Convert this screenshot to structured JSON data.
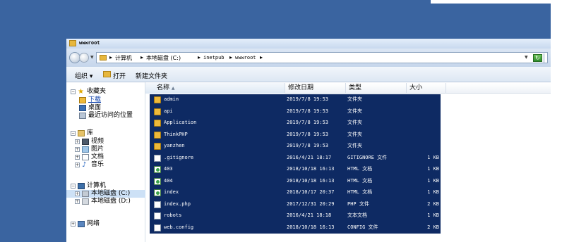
{
  "window": {
    "title": "wwwroot"
  },
  "address": {
    "crumbs": [
      "计算机",
      "本地磁盘 (C:)",
      "inetpub",
      "wwwroot"
    ],
    "separator": "▸"
  },
  "toolbar": {
    "organize": "组织 ▾",
    "open": "打开",
    "new_folder": "新建文件夹"
  },
  "nav": {
    "favorites": "收藏夹",
    "downloads": "下载",
    "desktop": "桌面",
    "recent": "最近访问的位置",
    "libraries": "库",
    "videos": "视频",
    "pictures": "图片",
    "documents": "文档",
    "music": "音乐",
    "computer": "计算机",
    "drive_c": "本地磁盘 (C:)",
    "drive_d": "本地磁盘 (D:)",
    "network": "网络"
  },
  "columns": {
    "name": "名称",
    "date": "修改日期",
    "type": "类型",
    "size": "大小"
  },
  "files": [
    {
      "name": "admin",
      "date": "2019/7/8 19:53",
      "type": "文件夹",
      "size": "",
      "icon": "folder"
    },
    {
      "name": "api",
      "date": "2019/7/8 19:53",
      "type": "文件夹",
      "size": "",
      "icon": "folder"
    },
    {
      "name": "Application",
      "date": "2019/7/8 19:53",
      "type": "文件夹",
      "size": "",
      "icon": "folder"
    },
    {
      "name": "ThinkPHP",
      "date": "2019/7/8 19:53",
      "type": "文件夹",
      "size": "",
      "icon": "folder"
    },
    {
      "name": "yanzhen",
      "date": "2019/7/8 19:53",
      "type": "文件夹",
      "size": "",
      "icon": "folder"
    },
    {
      "name": ".gitignore",
      "date": "2016/4/21 18:17",
      "type": "GITIGNORE 文件",
      "size": "1 KB",
      "icon": "document"
    },
    {
      "name": "403",
      "date": "2018/10/18 16:13",
      "type": "HTML 文档",
      "size": "1 KB",
      "icon": "web"
    },
    {
      "name": "404",
      "date": "2018/10/18 16:13",
      "type": "HTML 文档",
      "size": "1 KB",
      "icon": "web"
    },
    {
      "name": "index",
      "date": "2018/10/17 20:37",
      "type": "HTML 文档",
      "size": "1 KB",
      "icon": "web"
    },
    {
      "name": "index.php",
      "date": "2017/12/31 20:29",
      "type": "PHP 文件",
      "size": "2 KB",
      "icon": "document"
    },
    {
      "name": "robots",
      "date": "2016/4/21 18:18",
      "type": "文本文档",
      "size": "1 KB",
      "icon": "document"
    },
    {
      "name": "web.config",
      "date": "2018/10/18 16:13",
      "type": "CONFIG 文件",
      "size": "2 KB",
      "icon": "document"
    }
  ],
  "colors": {
    "desktop": "#3a64a0",
    "selection": "#0e2a63"
  }
}
